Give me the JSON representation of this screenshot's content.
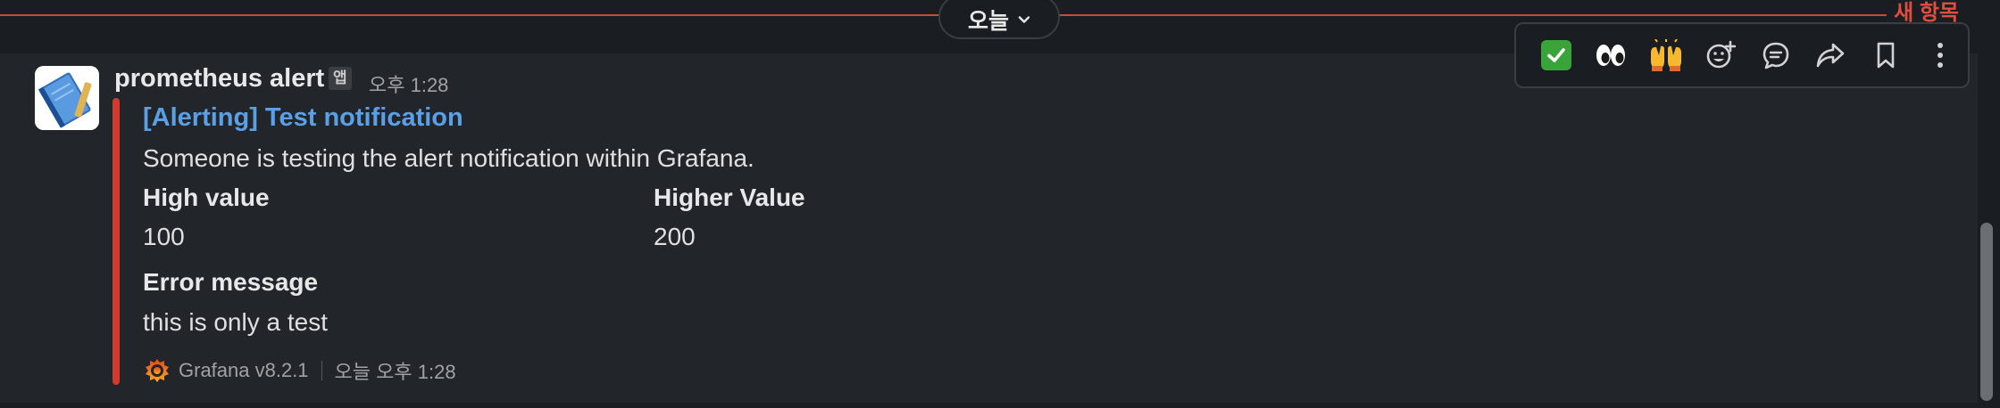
{
  "divider": {
    "day_label": "오늘",
    "new_label": "새 항목",
    "line_color": "#c74b3f"
  },
  "message": {
    "sender": "prometheus alert",
    "app_badge": "앱",
    "time": "오후 1:28",
    "avatar_icon": "notebook-icon"
  },
  "attachment": {
    "accent_color": "#d13a2e",
    "title": "[Alerting] Test notification",
    "text": "Someone is testing the alert notification within Grafana.",
    "fields": [
      {
        "title": "High value",
        "value": "100"
      },
      {
        "title": "Higher Value",
        "value": "200"
      },
      {
        "title": "Error message",
        "value": "this is only a test"
      }
    ],
    "footer": {
      "icon": "grafana-logo-icon",
      "source": "Grafana v8.2.1",
      "time": "오늘 오후 1:28"
    }
  },
  "toolbar": {
    "actions": [
      {
        "name": "check-mark-reaction",
        "icon": "white-check-mark-emoji"
      },
      {
        "name": "eyes-reaction",
        "icon": "eyes-emoji"
      },
      {
        "name": "raised-hands-reaction",
        "icon": "raised-hands-emoji"
      },
      {
        "name": "add-reaction",
        "icon": "add-emoji-icon"
      },
      {
        "name": "reply-in-thread",
        "icon": "thread-bubble-icon"
      },
      {
        "name": "share-message",
        "icon": "forward-arrow-icon"
      },
      {
        "name": "save-for-later",
        "icon": "bookmark-icon"
      },
      {
        "name": "more-actions",
        "icon": "vertical-ellipsis-icon"
      }
    ]
  }
}
